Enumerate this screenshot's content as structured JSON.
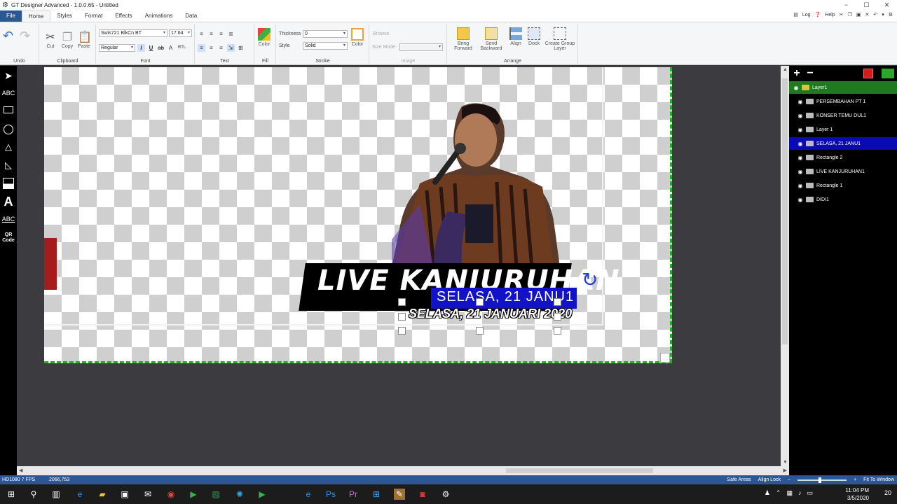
{
  "window": {
    "title": "GT Designer Advanced - 1.0.0.65 - Untitled",
    "app_icon": "gear-icon",
    "controls": [
      "−",
      "☐",
      "✕"
    ]
  },
  "tabs": [
    {
      "label": "File"
    },
    {
      "label": "Home"
    },
    {
      "label": "Styles"
    },
    {
      "label": "Format"
    },
    {
      "label": "Effects"
    },
    {
      "label": "Animations"
    },
    {
      "label": "Data"
    }
  ],
  "top_right": {
    "log": "Log",
    "help": "Help"
  },
  "ribbon": {
    "undo": {
      "group": "Undo"
    },
    "clipboard": {
      "group": "Clipboard",
      "cut": "Cut",
      "copy": "Copy",
      "paste": "Paste"
    },
    "font": {
      "group": "Font",
      "family": "Swis721 BlkCn BT",
      "size": "17.64",
      "style": "Regular",
      "rtl": "RTL"
    },
    "text": {
      "group": "Text"
    },
    "fill": {
      "group": "Fill",
      "color": "Color"
    },
    "stroke": {
      "group": "Stroke",
      "thickness_label": "Thickness",
      "thickness": "0",
      "style_label": "Style",
      "style": "Solid",
      "color": "Color"
    },
    "image": {
      "group": "Image",
      "browse": "Browse",
      "size_mode": "Size Mode"
    },
    "arrange": {
      "group": "Arrange",
      "bring_forward": "Bring Forward",
      "send_backward": "Send Backward",
      "align": "Align",
      "dock": "Dock",
      "create_group": "Create Group Layer"
    }
  },
  "left_tools": {
    "abc": "ABC",
    "text_a": "A",
    "abc2": "ABC",
    "qr": "QR Code"
  },
  "canvas": {
    "banner": "LIVE KANJURUHAN",
    "blue_text": "SELASA, 21 JANU1",
    "date_text": "SELASA, 21 JANUARI 2020"
  },
  "layers": {
    "group": "Layer1",
    "items": [
      {
        "label": "PERSEMBAHAN PT 1"
      },
      {
        "label": "KONSER TEMU DUL1"
      },
      {
        "label": "Layer 1"
      },
      {
        "label": "SELASA, 21 JANU1"
      },
      {
        "label": "Rectangle 2"
      },
      {
        "label": "LIVE KANJURUHAN1"
      },
      {
        "label": "Rectangle 1"
      },
      {
        "label": "DIDI1"
      }
    ],
    "selected_index": 3
  },
  "status": {
    "mode": "HD1080  7 FPS",
    "coords": "2066,753",
    "safe_areas": "Safe Areas",
    "align_lock": "Align Lock",
    "fit": "Fit To Window"
  },
  "taskbar": {
    "time": "11:04 PM",
    "date": "3/5/2020",
    "notifications": "20"
  }
}
